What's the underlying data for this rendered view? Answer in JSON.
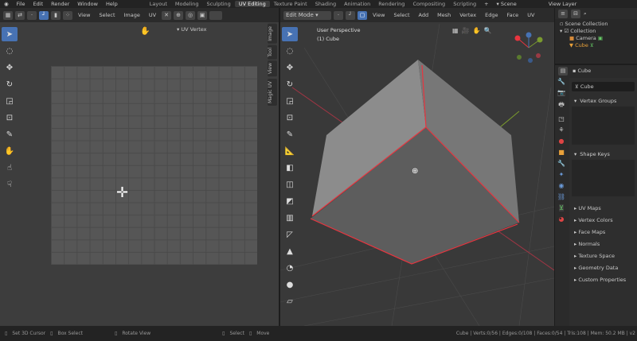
{
  "menu": [
    "File",
    "Edit",
    "Render",
    "Window",
    "Help"
  ],
  "workspaces": [
    {
      "label": "Layout"
    },
    {
      "label": "Modeling"
    },
    {
      "label": "Sculpting"
    },
    {
      "label": "UV Editing",
      "active": true
    },
    {
      "label": "Texture Paint"
    },
    {
      "label": "Shading"
    },
    {
      "label": "Animation"
    },
    {
      "label": "Rendering"
    },
    {
      "label": "Compositing"
    },
    {
      "label": "Scripting"
    }
  ],
  "add_workspace": "+",
  "scene": "Scene",
  "view_layer": "View Layer",
  "uv_editor": {
    "menus": [
      "View",
      "Select",
      "Image",
      "UV"
    ],
    "panel_label": "UV Vertex",
    "side_tabs": [
      "Image",
      "Tool",
      "View",
      "Magic UV"
    ]
  },
  "viewport": {
    "mode": "Edit Mode",
    "menus": [
      "View",
      "Select",
      "Add",
      "Mesh",
      "Vertex",
      "Edge",
      "Face",
      "UV"
    ],
    "perspective": "User Perspective",
    "object": "(1) Cube"
  },
  "outliner": {
    "root": "Scene Collection",
    "collection": "Collection",
    "items": [
      "Camera",
      "Cube"
    ]
  },
  "properties": {
    "object_name": "Cube",
    "mesh_name": "Cube",
    "sections": [
      "Vertex Groups",
      "Shape Keys",
      "UV Maps",
      "Vertex Colors",
      "Face Maps",
      "Normals",
      "Texture Space",
      "Geometry Data",
      "Custom Properties"
    ]
  },
  "status": {
    "left": [
      "Set 3D Cursor",
      "Box Select",
      "Rotate View",
      "Select",
      "Move"
    ],
    "stats": "Cube | Verts:0/56 | Edges:0/108 | Faces:0/54 | Tris:108 | Mem: 50.2 MB | v2"
  },
  "colors": {
    "accent": "#4772b3",
    "selected_edge": "#e8353f"
  }
}
